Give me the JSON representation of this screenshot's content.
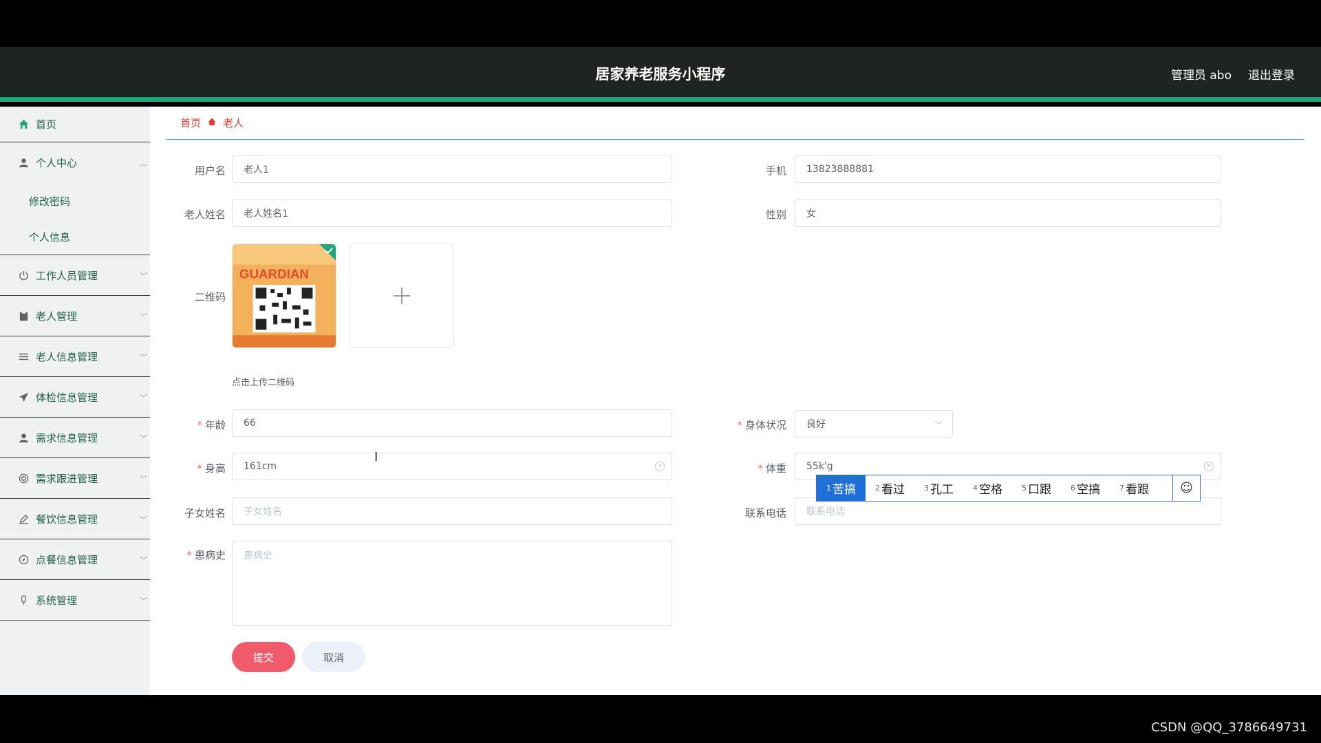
{
  "header": {
    "title": "居家养老服务小程序",
    "admin": "管理员 abo",
    "logout": "退出登录"
  },
  "sidebar": {
    "home": "首页",
    "personal": "个人中心",
    "personal_sub": [
      "修改密码",
      "个人信息"
    ],
    "items": [
      "工作人员管理",
      "老人管理",
      "老人信息管理",
      "体检信息管理",
      "需求信息管理",
      "需求跟进管理",
      "餐饮信息管理",
      "点餐信息管理",
      "系统管理"
    ]
  },
  "breadcrumb": {
    "home": "首页",
    "current": "老人"
  },
  "form": {
    "username_label": "用户名",
    "username": "老人1",
    "phone_label": "手机",
    "phone": "13823888881",
    "name_label": "老人姓名",
    "name": "老人姓名1",
    "gender_label": "性别",
    "gender": "女",
    "qr_label": "二维码",
    "qr_tip": "点击上传二维码",
    "qr_text": "GUARDIAN",
    "age_label": "年龄",
    "age": "66",
    "health_label": "身体状况",
    "health": "良好",
    "height_label": "身高",
    "height": "161cm",
    "weight_label": "体重",
    "weight": "55k'g",
    "child_label": "子女姓名",
    "child_placeholder": "子女姓名",
    "contact_label": "联系电话",
    "contact_placeholder": "联系电话",
    "history_label": "患病史",
    "history_placeholder": "患病史",
    "submit": "提交",
    "cancel": "取消"
  },
  "ime": {
    "candidates": [
      {
        "num": "1",
        "text": "苦搞"
      },
      {
        "num": "2",
        "text": "看过"
      },
      {
        "num": "3",
        "text": "孔工"
      },
      {
        "num": "4",
        "text": "空格"
      },
      {
        "num": "5",
        "text": "口跟"
      },
      {
        "num": "6",
        "text": "空搞"
      },
      {
        "num": "7",
        "text": "看跟"
      }
    ]
  },
  "watermark": "CSDN @QQ_3786649731",
  "colors": {
    "accent": "#1fa67a",
    "danger": "#f05a6a",
    "breadcrumb": "#e6382f"
  }
}
